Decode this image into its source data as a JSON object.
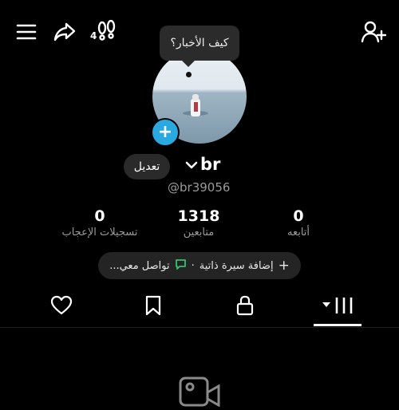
{
  "header": {
    "badge_count": "4"
  },
  "profile": {
    "bubble_text": "كيف الأخبار؟",
    "edit_label": "تعديل",
    "name": "br",
    "handle": "@br39056"
  },
  "stats": [
    {
      "value": "0",
      "label": "تسجيلات الإعجاب"
    },
    {
      "value": "1318",
      "label": "متابعين"
    },
    {
      "value": "0",
      "label": "أتابعه"
    }
  ],
  "bio": {
    "add_bio": "إضافة سيرة ذاتية",
    "separator": "·",
    "contact": "تواصل معي..."
  },
  "colors": {
    "accent_blue": "#2aa9e0",
    "contact_icon": "#33c26b",
    "muted_text": "#9a9a9a"
  }
}
